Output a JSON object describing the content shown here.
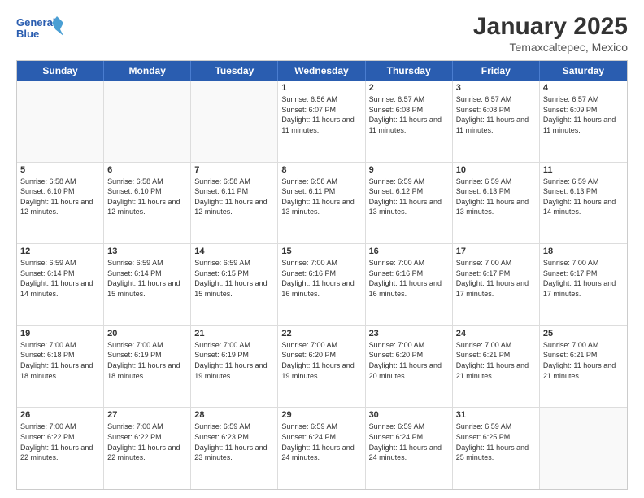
{
  "logo": {
    "line1": "General",
    "line2": "Blue"
  },
  "title": "January 2025",
  "subtitle": "Temaxcaltepec, Mexico",
  "header": {
    "days": [
      "Sunday",
      "Monday",
      "Tuesday",
      "Wednesday",
      "Thursday",
      "Friday",
      "Saturday"
    ]
  },
  "weeks": [
    {
      "cells": [
        {
          "day": "",
          "info": ""
        },
        {
          "day": "",
          "info": ""
        },
        {
          "day": "",
          "info": ""
        },
        {
          "day": "1",
          "info": "Sunrise: 6:56 AM\nSunset: 6:07 PM\nDaylight: 11 hours and 11 minutes."
        },
        {
          "day": "2",
          "info": "Sunrise: 6:57 AM\nSunset: 6:08 PM\nDaylight: 11 hours and 11 minutes."
        },
        {
          "day": "3",
          "info": "Sunrise: 6:57 AM\nSunset: 6:08 PM\nDaylight: 11 hours and 11 minutes."
        },
        {
          "day": "4",
          "info": "Sunrise: 6:57 AM\nSunset: 6:09 PM\nDaylight: 11 hours and 11 minutes."
        }
      ]
    },
    {
      "cells": [
        {
          "day": "5",
          "info": "Sunrise: 6:58 AM\nSunset: 6:10 PM\nDaylight: 11 hours and 12 minutes."
        },
        {
          "day": "6",
          "info": "Sunrise: 6:58 AM\nSunset: 6:10 PM\nDaylight: 11 hours and 12 minutes."
        },
        {
          "day": "7",
          "info": "Sunrise: 6:58 AM\nSunset: 6:11 PM\nDaylight: 11 hours and 12 minutes."
        },
        {
          "day": "8",
          "info": "Sunrise: 6:58 AM\nSunset: 6:11 PM\nDaylight: 11 hours and 13 minutes."
        },
        {
          "day": "9",
          "info": "Sunrise: 6:59 AM\nSunset: 6:12 PM\nDaylight: 11 hours and 13 minutes."
        },
        {
          "day": "10",
          "info": "Sunrise: 6:59 AM\nSunset: 6:13 PM\nDaylight: 11 hours and 13 minutes."
        },
        {
          "day": "11",
          "info": "Sunrise: 6:59 AM\nSunset: 6:13 PM\nDaylight: 11 hours and 14 minutes."
        }
      ]
    },
    {
      "cells": [
        {
          "day": "12",
          "info": "Sunrise: 6:59 AM\nSunset: 6:14 PM\nDaylight: 11 hours and 14 minutes."
        },
        {
          "day": "13",
          "info": "Sunrise: 6:59 AM\nSunset: 6:14 PM\nDaylight: 11 hours and 15 minutes."
        },
        {
          "day": "14",
          "info": "Sunrise: 6:59 AM\nSunset: 6:15 PM\nDaylight: 11 hours and 15 minutes."
        },
        {
          "day": "15",
          "info": "Sunrise: 7:00 AM\nSunset: 6:16 PM\nDaylight: 11 hours and 16 minutes."
        },
        {
          "day": "16",
          "info": "Sunrise: 7:00 AM\nSunset: 6:16 PM\nDaylight: 11 hours and 16 minutes."
        },
        {
          "day": "17",
          "info": "Sunrise: 7:00 AM\nSunset: 6:17 PM\nDaylight: 11 hours and 17 minutes."
        },
        {
          "day": "18",
          "info": "Sunrise: 7:00 AM\nSunset: 6:17 PM\nDaylight: 11 hours and 17 minutes."
        }
      ]
    },
    {
      "cells": [
        {
          "day": "19",
          "info": "Sunrise: 7:00 AM\nSunset: 6:18 PM\nDaylight: 11 hours and 18 minutes."
        },
        {
          "day": "20",
          "info": "Sunrise: 7:00 AM\nSunset: 6:19 PM\nDaylight: 11 hours and 18 minutes."
        },
        {
          "day": "21",
          "info": "Sunrise: 7:00 AM\nSunset: 6:19 PM\nDaylight: 11 hours and 19 minutes."
        },
        {
          "day": "22",
          "info": "Sunrise: 7:00 AM\nSunset: 6:20 PM\nDaylight: 11 hours and 19 minutes."
        },
        {
          "day": "23",
          "info": "Sunrise: 7:00 AM\nSunset: 6:20 PM\nDaylight: 11 hours and 20 minutes."
        },
        {
          "day": "24",
          "info": "Sunrise: 7:00 AM\nSunset: 6:21 PM\nDaylight: 11 hours and 21 minutes."
        },
        {
          "day": "25",
          "info": "Sunrise: 7:00 AM\nSunset: 6:21 PM\nDaylight: 11 hours and 21 minutes."
        }
      ]
    },
    {
      "cells": [
        {
          "day": "26",
          "info": "Sunrise: 7:00 AM\nSunset: 6:22 PM\nDaylight: 11 hours and 22 minutes."
        },
        {
          "day": "27",
          "info": "Sunrise: 7:00 AM\nSunset: 6:22 PM\nDaylight: 11 hours and 22 minutes."
        },
        {
          "day": "28",
          "info": "Sunrise: 6:59 AM\nSunset: 6:23 PM\nDaylight: 11 hours and 23 minutes."
        },
        {
          "day": "29",
          "info": "Sunrise: 6:59 AM\nSunset: 6:24 PM\nDaylight: 11 hours and 24 minutes."
        },
        {
          "day": "30",
          "info": "Sunrise: 6:59 AM\nSunset: 6:24 PM\nDaylight: 11 hours and 24 minutes."
        },
        {
          "day": "31",
          "info": "Sunrise: 6:59 AM\nSunset: 6:25 PM\nDaylight: 11 hours and 25 minutes."
        },
        {
          "day": "",
          "info": ""
        }
      ]
    }
  ]
}
